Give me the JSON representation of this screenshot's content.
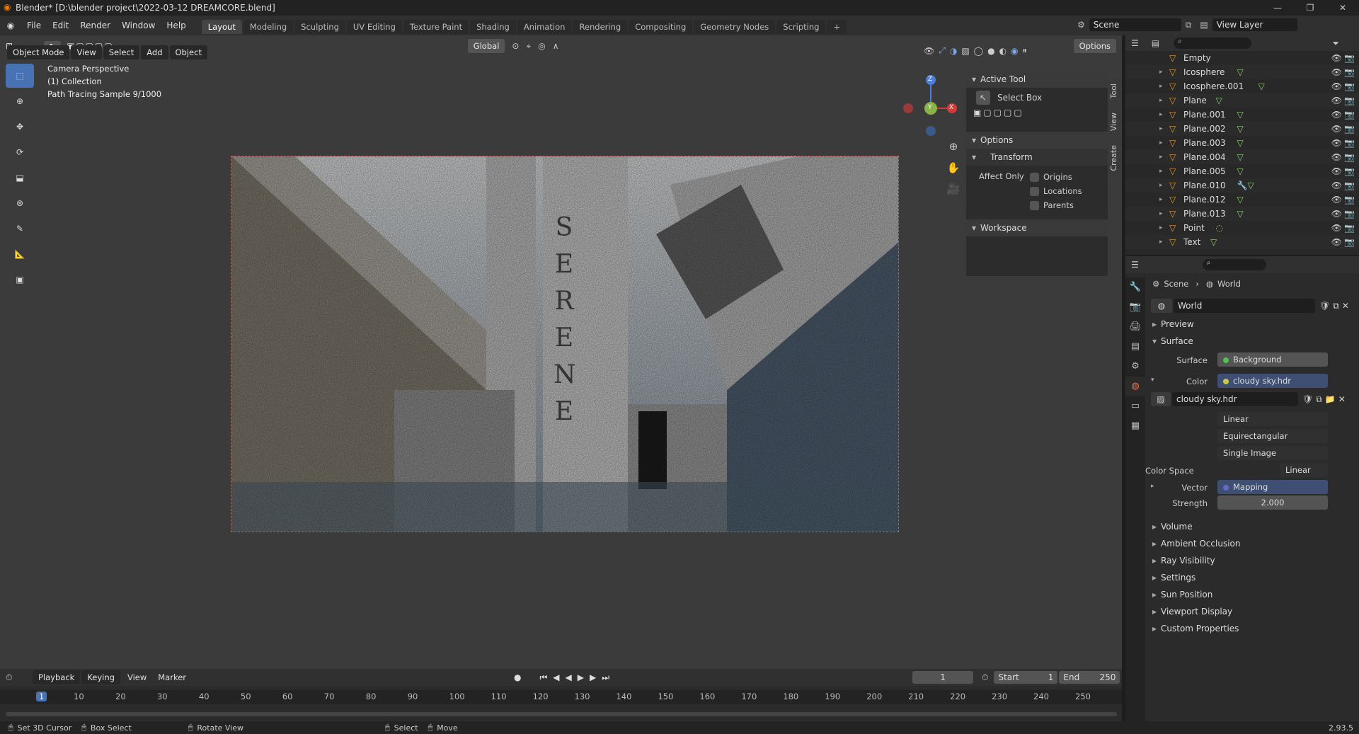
{
  "titlebar": {
    "title": "Blender* [D:\\blender project\\2022-03-12 DREAMCORE.blend]",
    "buttons": [
      "—",
      "❐",
      "✕"
    ]
  },
  "menu": {
    "items": [
      "File",
      "Edit",
      "Render",
      "Window",
      "Help"
    ]
  },
  "workspaces": [
    "Layout",
    "Modeling",
    "Sculpting",
    "UV Editing",
    "Texture Paint",
    "Shading",
    "Animation",
    "Rendering",
    "Compositing",
    "Geometry Nodes",
    "Scripting",
    "+"
  ],
  "scene": {
    "label": "Scene",
    "view_layer": "View Layer"
  },
  "viewport": {
    "mode": "Object Mode",
    "menus": [
      "View",
      "Select",
      "Add",
      "Object"
    ],
    "transform": "Global",
    "options": "Options",
    "overlay": [
      "Camera Perspective",
      "(1) Collection",
      "Path Tracing Sample 9/1000"
    ],
    "render_text": [
      "S",
      "E",
      "R",
      "E",
      "N",
      "E"
    ],
    "gizmo": {
      "z": "Z",
      "y": "Y",
      "x": "X"
    }
  },
  "npanel": {
    "active_tool": "Active Tool",
    "tool_name": "Select Box",
    "options": "Options",
    "transform": "Transform",
    "affect_only": "Affect Only",
    "affect": [
      "Origins",
      "Locations",
      "Parents"
    ],
    "workspace": "Workspace",
    "tabs": [
      "Tool",
      "View",
      "Create"
    ]
  },
  "outliner": {
    "items": [
      {
        "name": "Empty",
        "extra": ""
      },
      {
        "name": "Icosphere",
        "extra": "▽"
      },
      {
        "name": "Icosphere.001",
        "extra": "▽"
      },
      {
        "name": "Plane",
        "extra": "▽"
      },
      {
        "name": "Plane.001",
        "extra": "▽"
      },
      {
        "name": "Plane.002",
        "extra": "▽"
      },
      {
        "name": "Plane.003",
        "extra": "▽"
      },
      {
        "name": "Plane.004",
        "extra": "▽"
      },
      {
        "name": "Plane.005",
        "extra": "▽"
      },
      {
        "name": "Plane.010",
        "extra": "🔧▽"
      },
      {
        "name": "Plane.012",
        "extra": "▽"
      },
      {
        "name": "Plane.013",
        "extra": "▽"
      },
      {
        "name": "Point",
        "extra": "◌"
      },
      {
        "name": "Text",
        "extra": "▽"
      }
    ]
  },
  "properties": {
    "breadcrumb": [
      "Scene",
      "World"
    ],
    "world_name": "World",
    "sections": {
      "preview": "Preview",
      "surface": "Surface"
    },
    "surface_label": "Surface",
    "surface_value": "Background",
    "color_label": "Color",
    "color_value": "cloudy sky.hdr",
    "image_name": "cloudy sky.hdr",
    "interp": "Linear",
    "projection": "Equirectangular",
    "source": "Single Image",
    "colorspace_label": "Color Space",
    "colorspace_value": "Linear",
    "vector_label": "Vector",
    "vector_value": "Mapping",
    "strength_label": "Strength",
    "strength_value": "2.000",
    "closed": [
      "Volume",
      "Ambient Occlusion",
      "Ray Visibility",
      "Settings",
      "Sun Position",
      "Viewport Display",
      "Custom Properties"
    ]
  },
  "timeline": {
    "menus": [
      "Playback",
      "Keying",
      "View",
      "Marker"
    ],
    "current": "1",
    "start_label": "Start",
    "start": "1",
    "end_label": "End",
    "end": "250",
    "ticks": [
      "1",
      "10",
      "20",
      "30",
      "40",
      "50",
      "60",
      "70",
      "80",
      "90",
      "100",
      "110",
      "120",
      "130",
      "140",
      "150",
      "160",
      "170",
      "180",
      "190",
      "200",
      "210",
      "220",
      "230",
      "240",
      "250"
    ]
  },
  "status": {
    "items": [
      "Set 3D Cursor",
      "Box Select",
      "Rotate View",
      "Select",
      "Move"
    ],
    "version": "2.93.5"
  }
}
